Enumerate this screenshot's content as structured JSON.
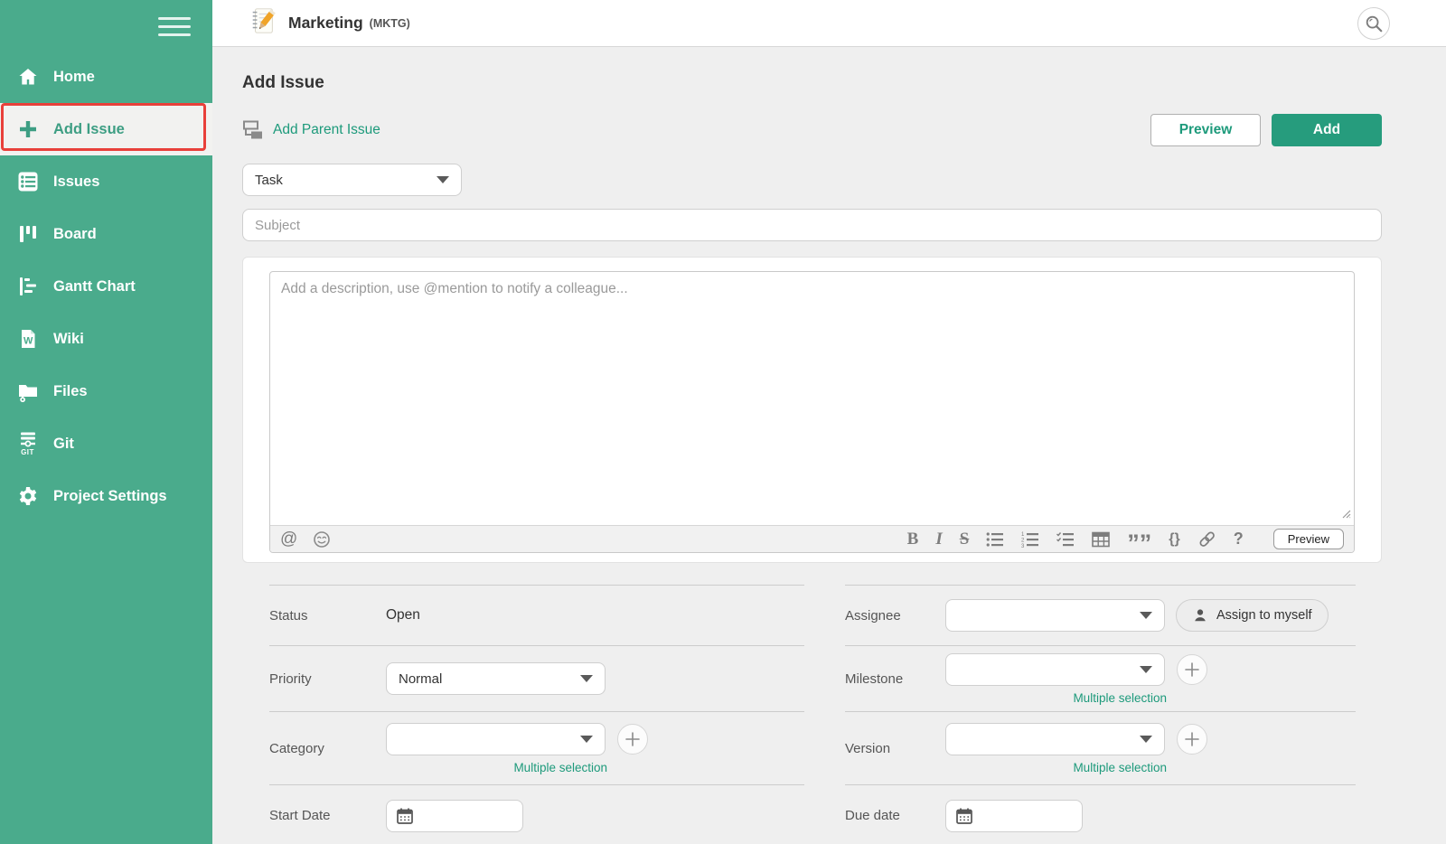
{
  "colors": {
    "sidebar_green": "#4aab8c",
    "accent_teal": "#1d9a7b",
    "add_button_green": "#269c7d",
    "annotation_red": "#e8403a",
    "page_background": "#efefef"
  },
  "sidebar": {
    "items": [
      {
        "label": "Home",
        "icon": "home-icon",
        "active": false
      },
      {
        "label": "Add Issue",
        "icon": "plus-icon",
        "active": true
      },
      {
        "label": "Issues",
        "icon": "issues-list-icon",
        "active": false
      },
      {
        "label": "Board",
        "icon": "board-icon",
        "active": false
      },
      {
        "label": "Gantt Chart",
        "icon": "gantt-icon",
        "active": false
      },
      {
        "label": "Wiki",
        "icon": "wiki-icon",
        "active": false
      },
      {
        "label": "Files",
        "icon": "files-icon",
        "active": false
      },
      {
        "label": "Git",
        "icon": "git-icon",
        "badge": "GIT",
        "active": false
      },
      {
        "label": "Project Settings",
        "icon": "gear-icon",
        "active": false
      }
    ]
  },
  "header": {
    "project_name": "Marketing",
    "project_key": "(MKTG)"
  },
  "page": {
    "title": "Add Issue",
    "add_parent_issue": "Add Parent Issue",
    "preview_button": "Preview",
    "add_button": "Add",
    "issue_type": {
      "value": "Task"
    },
    "subject_placeholder": "Subject",
    "editor": {
      "description_placeholder": "Add a description, use @mention to notify a colleague...",
      "preview_button": "Preview",
      "toolbar_icons": [
        "mention",
        "emoji",
        "bold",
        "italic",
        "strikethrough",
        "bullet-list",
        "numbered-list",
        "check-list",
        "table",
        "quote",
        "code-braces",
        "link",
        "help"
      ],
      "glyphs": {
        "mention": "@",
        "bold": "B",
        "italic": "I",
        "strikethrough": "S",
        "quote": "”",
        "braces": "{}",
        "help": "?"
      }
    },
    "fields": {
      "status": {
        "label": "Status",
        "value": "Open"
      },
      "priority": {
        "label": "Priority",
        "value": "Normal"
      },
      "category": {
        "label": "Category",
        "value": "",
        "multiple_selection": "Multiple selection"
      },
      "start_date": {
        "label": "Start Date",
        "value": ""
      },
      "assignee": {
        "label": "Assignee",
        "value": "",
        "assign_to_myself": "Assign to myself"
      },
      "milestone": {
        "label": "Milestone",
        "value": "",
        "multiple_selection": "Multiple selection"
      },
      "version": {
        "label": "Version",
        "value": "",
        "multiple_selection": "Multiple selection"
      },
      "due_date": {
        "label": "Due date",
        "value": ""
      }
    }
  }
}
